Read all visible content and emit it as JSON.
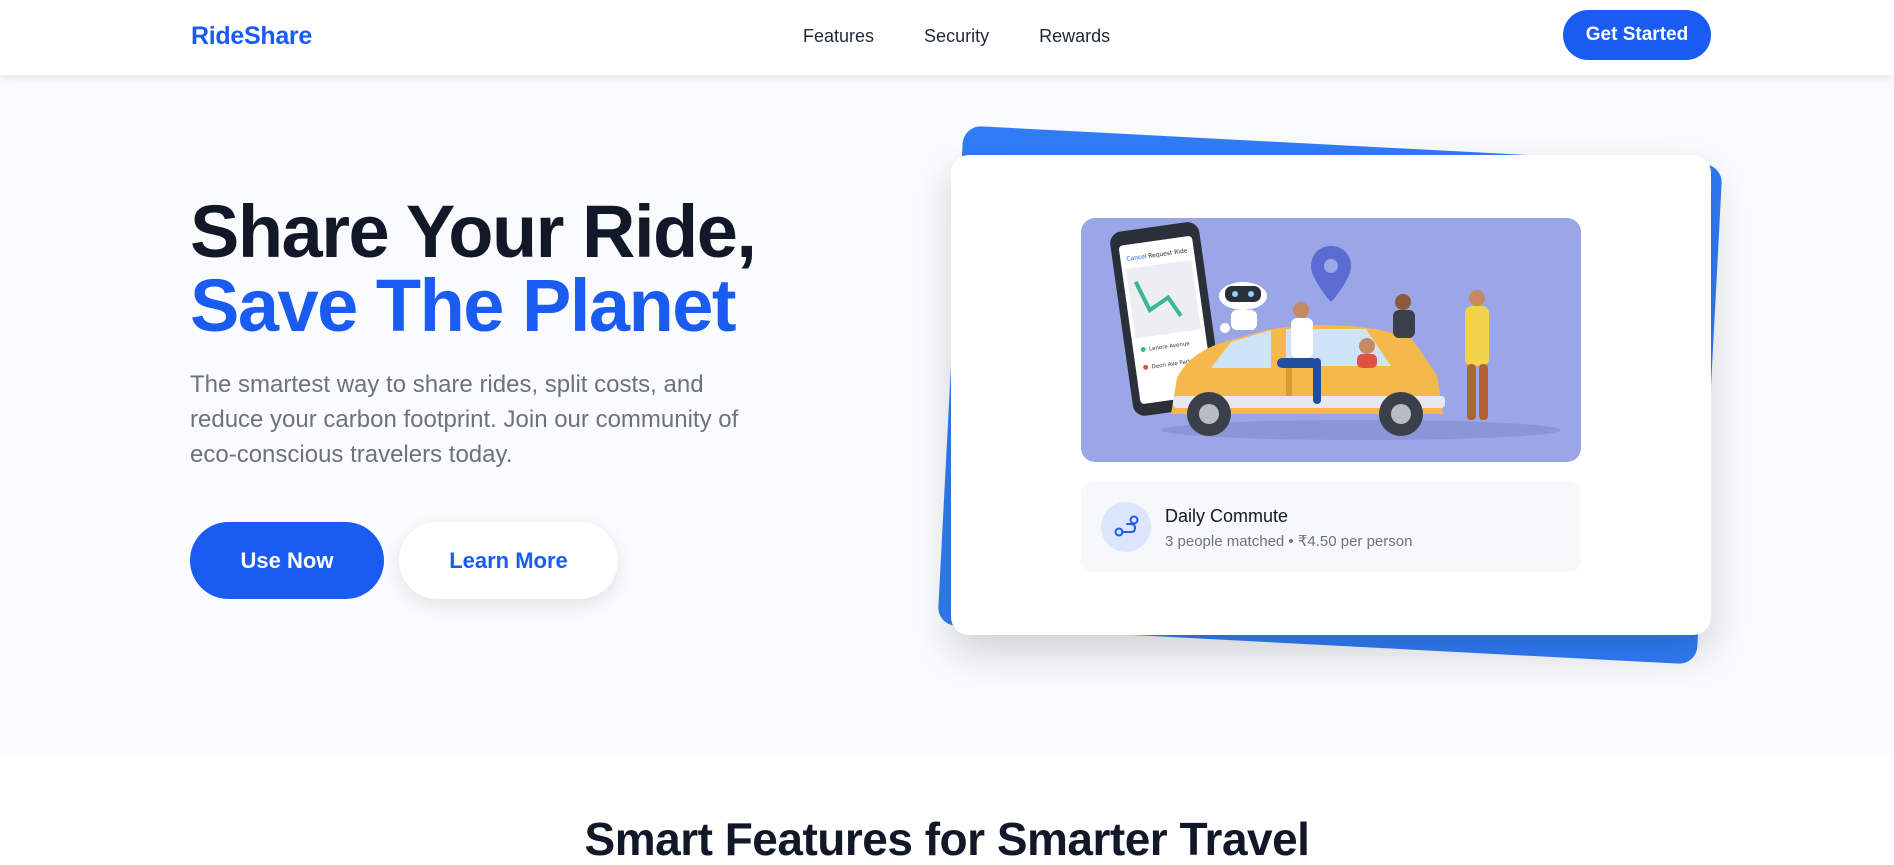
{
  "header": {
    "logo": "RideShare",
    "nav": [
      "Features",
      "Security",
      "Rewards"
    ],
    "cta": "Get Started"
  },
  "hero": {
    "title_line1": "Share Your Ride,",
    "title_line2": "Save The Planet",
    "description": "The smartest way to share rides, split costs, and reduce your carbon footprint. Join our community of eco-conscious travelers today.",
    "primary_button": "Use Now",
    "secondary_button": "Learn More"
  },
  "card": {
    "ride_title": "Daily Commute",
    "ride_subtitle": "3 people matched • ₹4.50 per person",
    "phone_header_left": "Cancel",
    "phone_header_title": "Request Ride",
    "phone_stop_1": "Lenore Avenue",
    "phone_stop_2": "Deon Ave Park"
  },
  "features": {
    "title": "Smart Features for Smarter Travel"
  },
  "colors": {
    "accent": "#1a5cf2",
    "card_back": "#2f7cf6",
    "illustration_bg": "#9aa6e6"
  }
}
